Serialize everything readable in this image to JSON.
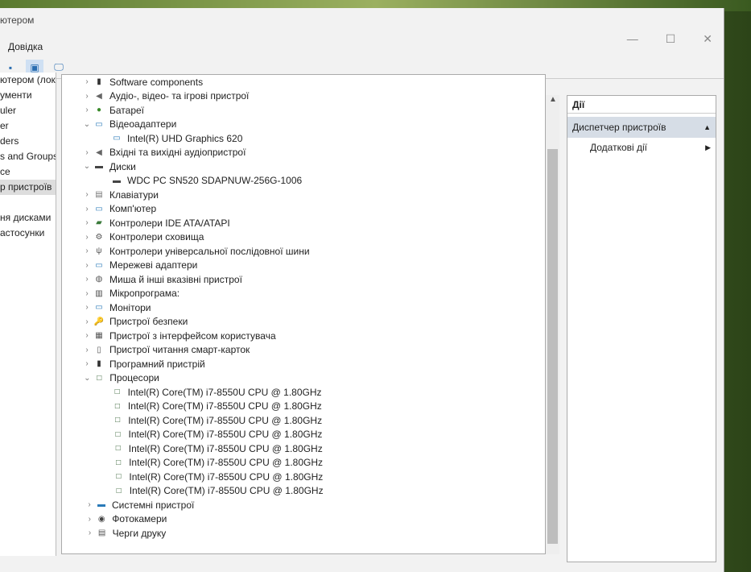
{
  "window": {
    "title": "ютером",
    "menu": [
      "Довідка"
    ],
    "controls": {
      "minimize": "—",
      "maximize": "☐",
      "close": "✕"
    }
  },
  "left_pane": {
    "items": [
      {
        "label": "ютером (лока",
        "selected": false
      },
      {
        "label": "ументи",
        "selected": false
      },
      {
        "label": "uler",
        "selected": false
      },
      {
        "label": "er",
        "selected": false
      },
      {
        "label": "ders",
        "selected": false
      },
      {
        "label": "s and Groups",
        "selected": false
      },
      {
        "label": "ce",
        "selected": false
      },
      {
        "label": "р пристроїв",
        "selected": true
      },
      {
        "label": "",
        "selected": false
      },
      {
        "label": "ня дисками",
        "selected": false
      },
      {
        "label": "астосунки",
        "selected": false
      }
    ]
  },
  "tree": [
    {
      "label": "Software components",
      "level": 0,
      "exp": "›",
      "icon": "▮",
      "color": "#333"
    },
    {
      "label": "Аудіо-, відео- та ігрові пристрої",
      "level": 0,
      "exp": "›",
      "icon": "◀",
      "color": "#666"
    },
    {
      "label": "Батареї",
      "level": 0,
      "exp": "›",
      "icon": "●",
      "color": "#3a8a2a"
    },
    {
      "label": "Відеоадаптери",
      "level": 0,
      "exp": "⌄",
      "icon": "▭",
      "color": "#2a7ab8"
    },
    {
      "label": "Intel(R) UHD Graphics 620",
      "level": 1,
      "exp": "",
      "icon": "▭",
      "color": "#2a7ab8"
    },
    {
      "label": "Вхідні та вихідні аудіопристрої",
      "level": 0,
      "exp": "›",
      "icon": "◀",
      "color": "#666"
    },
    {
      "label": "Диски",
      "level": 0,
      "exp": "⌄",
      "icon": "▬",
      "color": "#444"
    },
    {
      "label": "WDC PC SN520 SDAPNUW-256G-1006",
      "level": 1,
      "exp": "",
      "icon": "▬",
      "color": "#444"
    },
    {
      "label": "Клавіатури",
      "level": 0,
      "exp": "›",
      "icon": "▤",
      "color": "#777"
    },
    {
      "label": "Комп'ютер",
      "level": 0,
      "exp": "›",
      "icon": "▭",
      "color": "#2a7ab8"
    },
    {
      "label": "Контролери IDE ATA/ATAPI",
      "level": 0,
      "exp": "›",
      "icon": "▰",
      "color": "#3a7a3a"
    },
    {
      "label": "Контролери сховища",
      "level": 0,
      "exp": "›",
      "icon": "⚙",
      "color": "#555"
    },
    {
      "label": "Контролери універсальної послідовної шини",
      "level": 0,
      "exp": "›",
      "icon": "ψ",
      "color": "#555"
    },
    {
      "label": "Мережеві адаптери",
      "level": 0,
      "exp": "›",
      "icon": "▭",
      "color": "#2a7ab8"
    },
    {
      "label": "Миша й інші вказівні пристрої",
      "level": 0,
      "exp": "›",
      "icon": "◍",
      "color": "#555"
    },
    {
      "label": "Мікропрограма:",
      "level": 0,
      "exp": "›",
      "icon": "▥",
      "color": "#444"
    },
    {
      "label": "Монітори",
      "level": 0,
      "exp": "›",
      "icon": "▭",
      "color": "#2a7ab8"
    },
    {
      "label": "Пристрої безпеки",
      "level": 0,
      "exp": "›",
      "icon": "🔑",
      "color": "#b89020"
    },
    {
      "label": "Пристрої з інтерфейсом користувача",
      "level": 0,
      "exp": "›",
      "icon": "▦",
      "color": "#555"
    },
    {
      "label": "Пристрої читання смарт-карток",
      "level": 0,
      "exp": "›",
      "icon": "▯",
      "color": "#555"
    },
    {
      "label": "Програмний пристрій",
      "level": 0,
      "exp": "›",
      "icon": "▮",
      "color": "#333"
    },
    {
      "label": "Процесори",
      "level": 0,
      "exp": "⌄",
      "icon": "□",
      "color": "#2a5a2a"
    },
    {
      "label": "Intel(R) Core(TM) i7-8550U CPU @ 1.80GHz",
      "level": 1,
      "exp": "",
      "icon": "□",
      "color": "#2a5a2a"
    },
    {
      "label": "Intel(R) Core(TM) i7-8550U CPU @ 1.80GHz",
      "level": 1,
      "exp": "",
      "icon": "□",
      "color": "#2a5a2a"
    },
    {
      "label": "Intel(R) Core(TM) i7-8550U CPU @ 1.80GHz",
      "level": 1,
      "exp": "",
      "icon": "□",
      "color": "#2a5a2a"
    },
    {
      "label": "Intel(R) Core(TM) i7-8550U CPU @ 1.80GHz",
      "level": 1,
      "exp": "",
      "icon": "□",
      "color": "#2a5a2a"
    },
    {
      "label": "Intel(R) Core(TM) i7-8550U CPU @ 1.80GHz",
      "level": 1,
      "exp": "",
      "icon": "□",
      "color": "#2a5a2a"
    },
    {
      "label": "Intel(R) Core(TM) i7-8550U CPU @ 1.80GHz",
      "level": 1,
      "exp": "",
      "icon": "□",
      "color": "#2a5a2a"
    },
    {
      "label": "Intel(R) Core(TM) i7-8550U CPU @ 1.80GHz",
      "level": 1,
      "exp": "",
      "icon": "□",
      "color": "#2a5a2a"
    },
    {
      "label": "Intel(R) Core(TM) i7-8550U CPU @ 1.80GHz",
      "level": 1,
      "exp": "",
      "icon": "□",
      "color": "#2a5a2a"
    },
    {
      "label": "Системні пристрої",
      "level": 0,
      "exp": "›",
      "icon": "▬",
      "color": "#2a7ab8"
    },
    {
      "label": "Фотокамери",
      "level": 0,
      "exp": "›",
      "icon": "◉",
      "color": "#444"
    },
    {
      "label": "Черги друку",
      "level": 0,
      "exp": "›",
      "icon": "▤",
      "color": "#555"
    }
  ],
  "actions": {
    "header": "Дії",
    "section": "Диспетчер пристроїв",
    "section_arrow": "▲",
    "items": [
      {
        "label": "Додаткові дії",
        "arrow": "▶"
      }
    ]
  }
}
